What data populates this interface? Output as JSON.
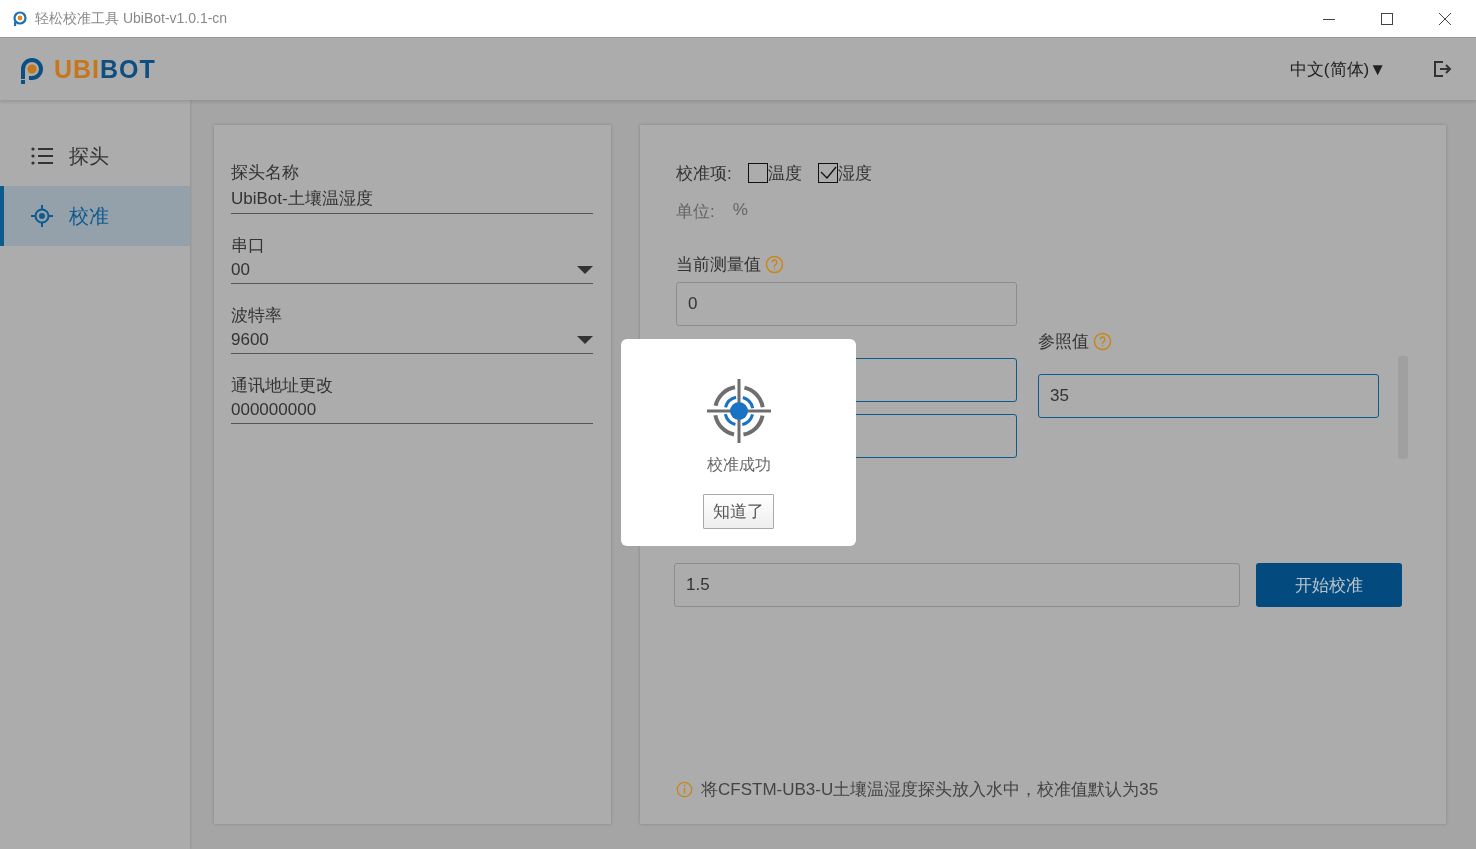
{
  "window": {
    "title": "轻松校准工具 UbiBot-v1.0.1-cn"
  },
  "header": {
    "logo": "UBIBOT",
    "language": "中文(简体)▼"
  },
  "sidebar": {
    "items": [
      {
        "label": "探头",
        "kind": "list",
        "selected": false
      },
      {
        "label": "校准",
        "kind": "target",
        "selected": true
      }
    ]
  },
  "probe": {
    "fields": [
      {
        "label": "探头名称",
        "value": "UbiBot-土壤温湿度",
        "kind": "text"
      },
      {
        "label": "串口",
        "value": "00",
        "kind": "select"
      },
      {
        "label": "波特率",
        "value": "9600",
        "kind": "select"
      },
      {
        "label": "通讯地址更改",
        "value": "000000000",
        "kind": "text"
      }
    ]
  },
  "calibration": {
    "items_label": "校准项:",
    "items": [
      {
        "label": "温度",
        "checked": false
      },
      {
        "label": "湿度",
        "checked": true
      }
    ],
    "unit_label": "单位:",
    "unit": "%",
    "current_label": "当前测量值",
    "current_value": "0",
    "reference_label": "参照值",
    "reference_value": "35",
    "average_value": "1.5",
    "start_button": "开始校准",
    "note": "将CFSTM-UB3-U土壤温湿度探头放入水中，校准值默认为35"
  },
  "dialog": {
    "message": "校准成功",
    "button": "知道了"
  }
}
